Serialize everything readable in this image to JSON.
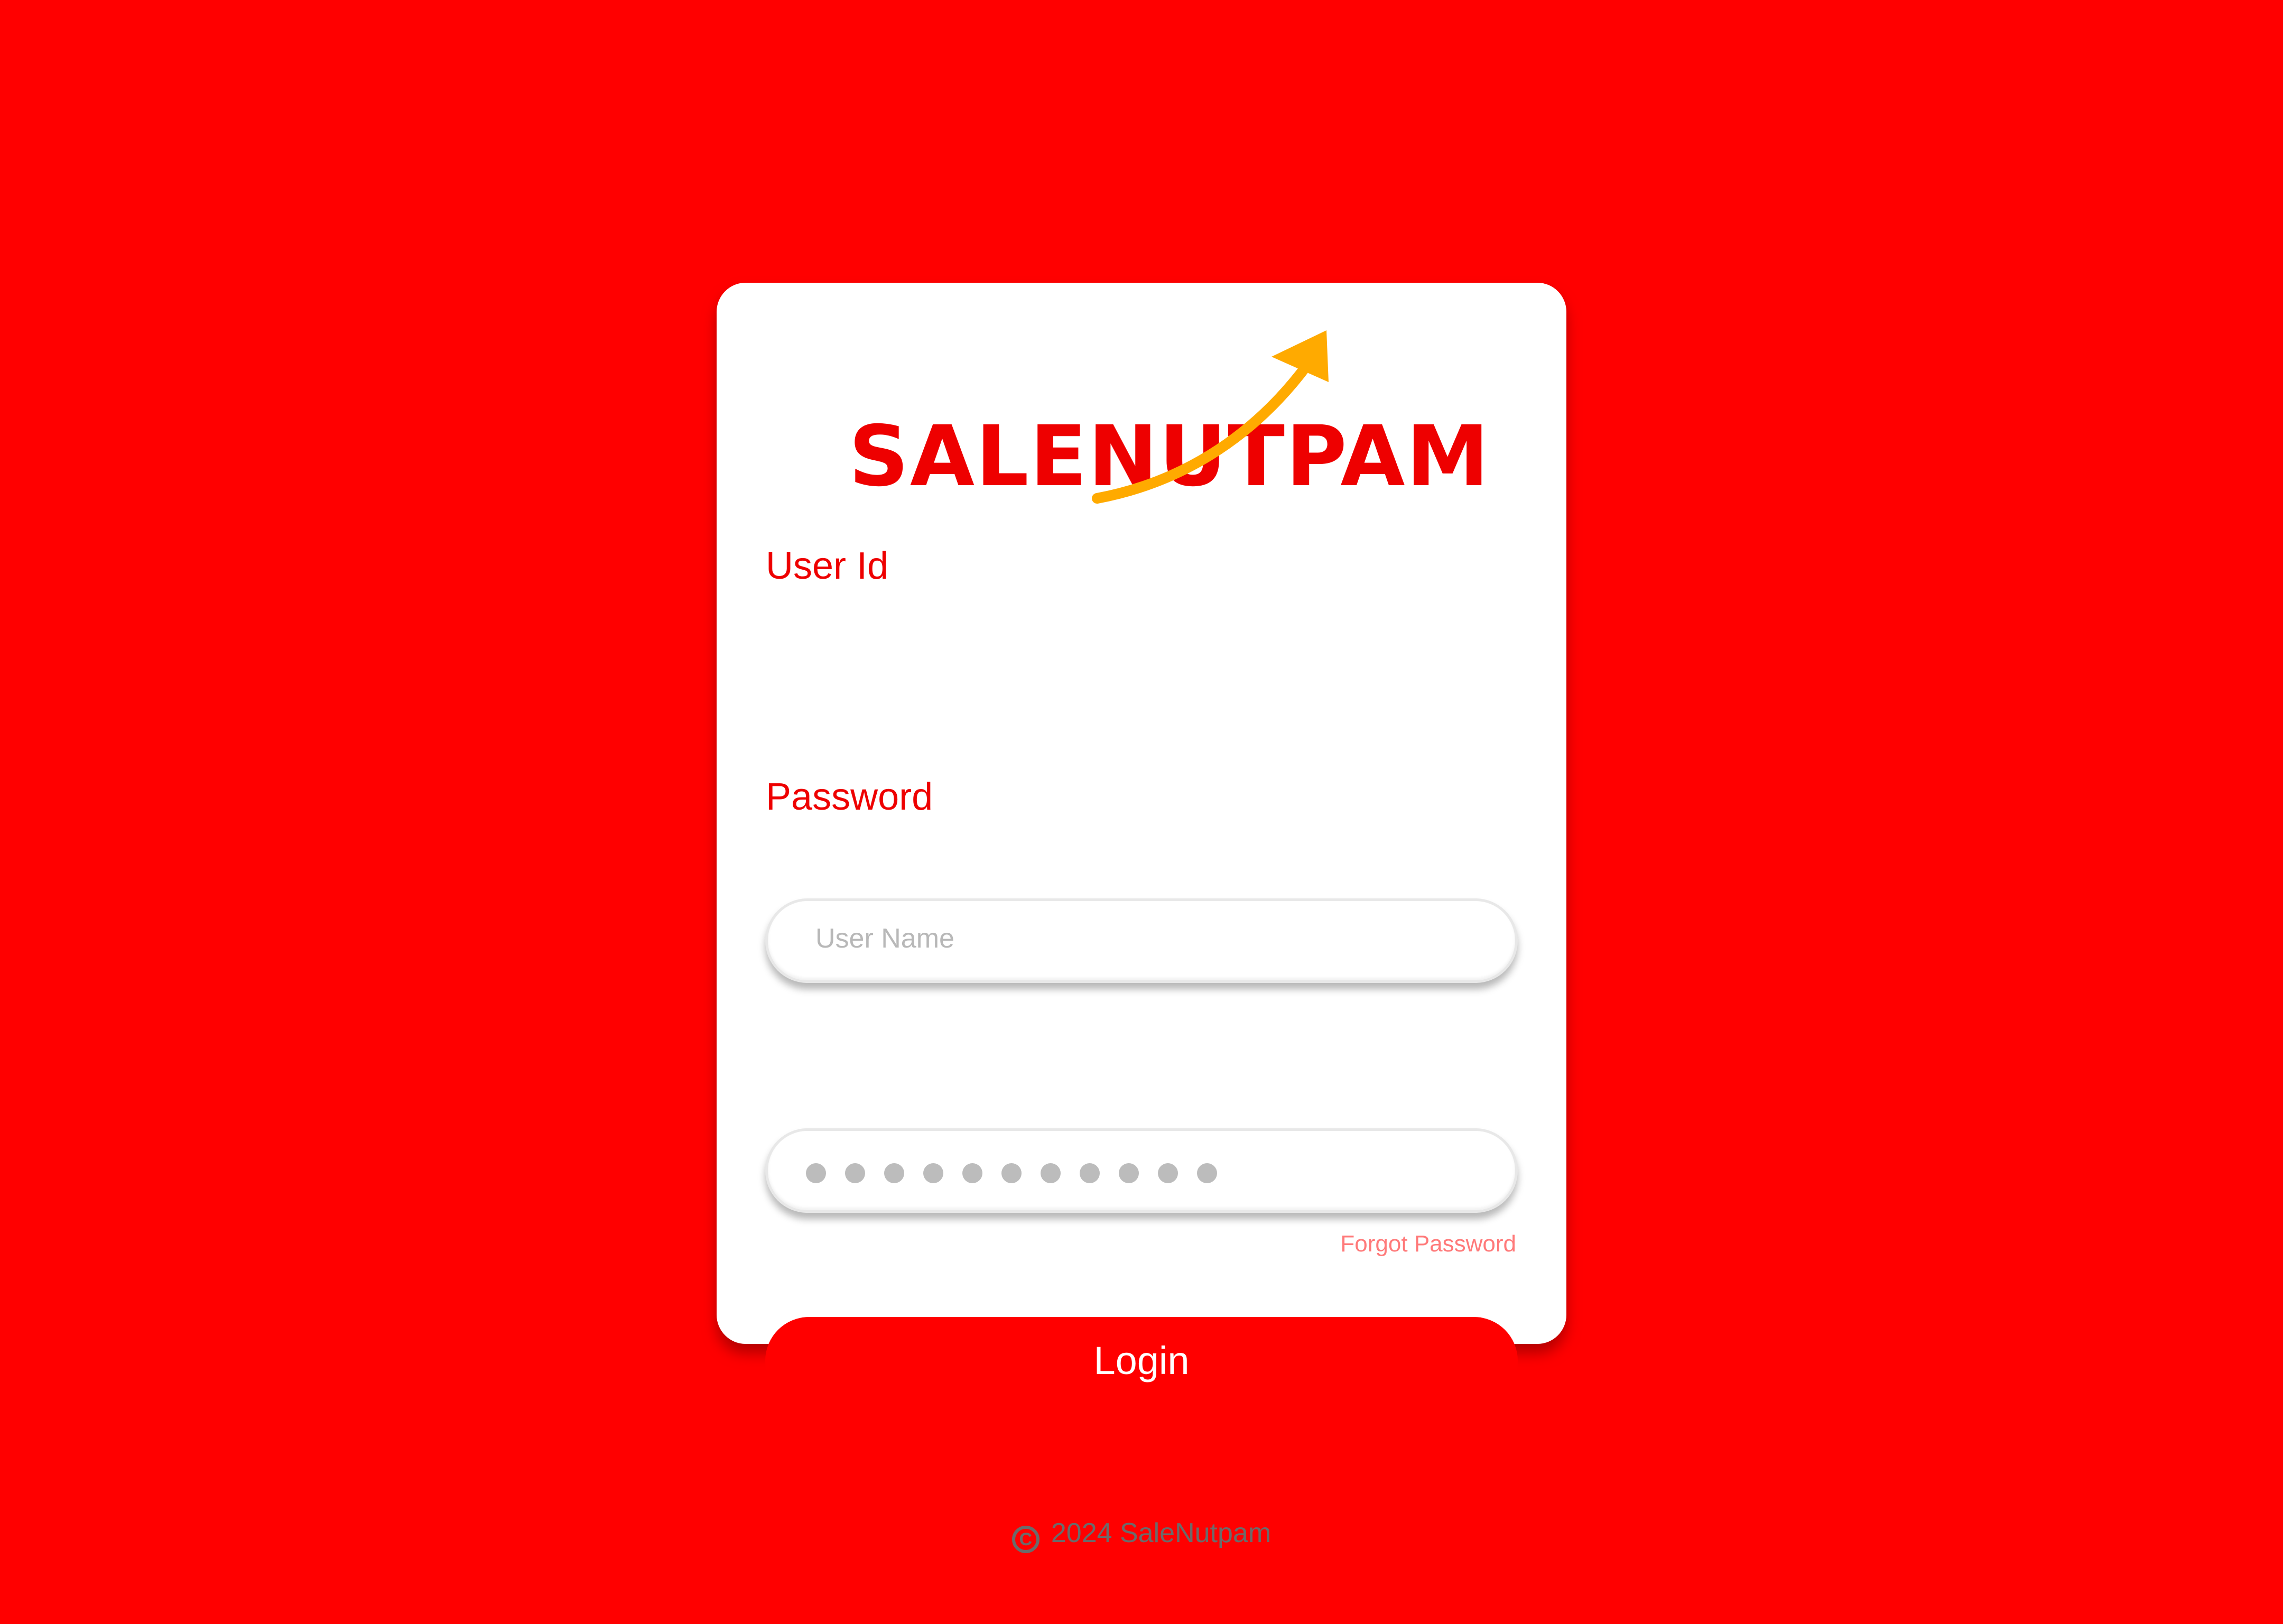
{
  "brand": {
    "logo_text": "SALENUTPAM",
    "text_color": "#ee0000",
    "arrow_color": "#ffaa00"
  },
  "background_color": "#ff0000",
  "form": {
    "user_label": "User Id",
    "user_placeholder": "User Name",
    "password_label": "Password",
    "password_mask_count": 11,
    "forgot_link": "Forgot Password",
    "login_label": "Login"
  },
  "footer": {
    "icon": "copyright-icon",
    "icon_glyph": "C",
    "text": "2024 SaleNutpam"
  }
}
